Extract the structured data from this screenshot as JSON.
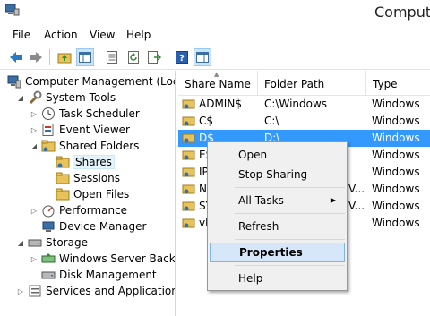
{
  "window": {
    "title": "Computer"
  },
  "menu": [
    "File",
    "Action",
    "View",
    "Help"
  ],
  "tree": {
    "root": "Computer Management (Local",
    "system_tools": "System Tools",
    "task_scheduler": "Task Scheduler",
    "event_viewer": "Event Viewer",
    "shared_folders": "Shared Folders",
    "shares": "Shares",
    "sessions": "Sessions",
    "open_files": "Open Files",
    "performance": "Performance",
    "device_manager": "Device Manager",
    "storage": "Storage",
    "windows_server_backup": "Windows Server Backup",
    "disk_management": "Disk Management",
    "services_apps": "Services and Applications"
  },
  "list": {
    "columns": [
      "Share Name",
      "Folder Path",
      "Type"
    ],
    "rows": [
      {
        "name": "ADMIN$",
        "path": "C:\\Windows",
        "type": "Windows"
      },
      {
        "name": "C$",
        "path": "C:\\",
        "type": "Windows"
      },
      {
        "name": "D$",
        "path": "D:\\",
        "type": "Windows"
      },
      {
        "name": "ES",
        "path": "",
        "type": "Windows"
      },
      {
        "name": "IP",
        "path": "",
        "type": "Windows"
      },
      {
        "name": "N",
        "path": "V...",
        "type": "Windows"
      },
      {
        "name": "SY",
        "path": "V...",
        "type": "Windows"
      },
      {
        "name": "vh",
        "path": "",
        "type": "Windows"
      }
    ]
  },
  "context_menu": {
    "open": "Open",
    "stop_sharing": "Stop Sharing",
    "all_tasks": "All Tasks",
    "refresh": "Refresh",
    "properties": "Properties",
    "help": "Help"
  },
  "colors": {
    "selection": "#3399ff",
    "accent": "#2b6cb3"
  }
}
